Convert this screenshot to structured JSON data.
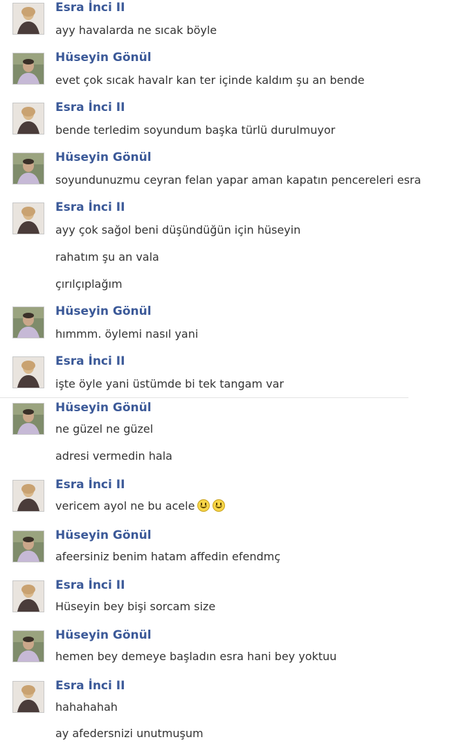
{
  "users": {
    "esra": "Esra İnci II",
    "huseyin": "Hüseyin Gönül"
  },
  "messages": [
    {
      "sender": "Esra İnci II",
      "avatar": "esra-avatar",
      "lines": [
        "ayy havalarda ne sıcak böyle"
      ]
    },
    {
      "sender": "Hüseyin Gönül",
      "avatar": "huseyin-avatar",
      "lines": [
        "evet çok sıcak havalr kan ter içinde kaldım şu an bende"
      ]
    },
    {
      "sender": "Esra İnci II",
      "avatar": "esra-avatar",
      "lines": [
        "bende terledim soyundum başka türlü durulmuyor"
      ]
    },
    {
      "sender": "Hüseyin Gönül",
      "avatar": "huseyin-avatar",
      "lines": [
        "soyundunuzmu ceyran felan yapar aman kapatın pencereleri esra"
      ]
    },
    {
      "sender": "Esra İnci II",
      "avatar": "esra-avatar",
      "lines": [
        "ayy çok sağol beni düşündüğün için hüseyin",
        "rahatım şu an vala",
        "çırılçıplağım"
      ]
    },
    {
      "sender": "Hüseyin Gönül",
      "avatar": "huseyin-avatar",
      "lines": [
        "hımmm. öylemi nasıl yani"
      ]
    },
    {
      "sender": "Esra İnci II",
      "avatar": "esra-avatar",
      "lines": [
        "işte öyle yani üstümde bi tek tangam var"
      ]
    },
    {
      "sender": "Hüseyin Gönül",
      "avatar": "huseyin-avatar",
      "lines": [
        "ne güzel ne güzel",
        "adresi vermedin hala"
      ]
    },
    {
      "sender": "Esra İnci II",
      "avatar": "esra-avatar",
      "lines": [
        "vericem ayol ne bu acele"
      ],
      "emojis": [
        "smiley-icon",
        "smiley-icon"
      ]
    },
    {
      "sender": "Hüseyin Gönül",
      "avatar": "huseyin-avatar",
      "lines": [
        "afeersiniz benim hatam affedin efendmç"
      ]
    },
    {
      "sender": "Esra İnci II",
      "avatar": "esra-avatar",
      "lines": [
        "Hüseyin bey  bişi sorcam size"
      ]
    },
    {
      "sender": "Hüseyin Gönül",
      "avatar": "huseyin-avatar",
      "lines": [
        "hemen bey demeye başladın esra hani bey yoktuu"
      ]
    },
    {
      "sender": "Esra İnci II",
      "avatar": "esra-avatar",
      "lines": [
        "hahahahah",
        "ay afedersnizi unutmuşum"
      ]
    }
  ],
  "colors": {
    "sender": "#3b5998",
    "text": "#333333",
    "background": "#ffffff"
  }
}
